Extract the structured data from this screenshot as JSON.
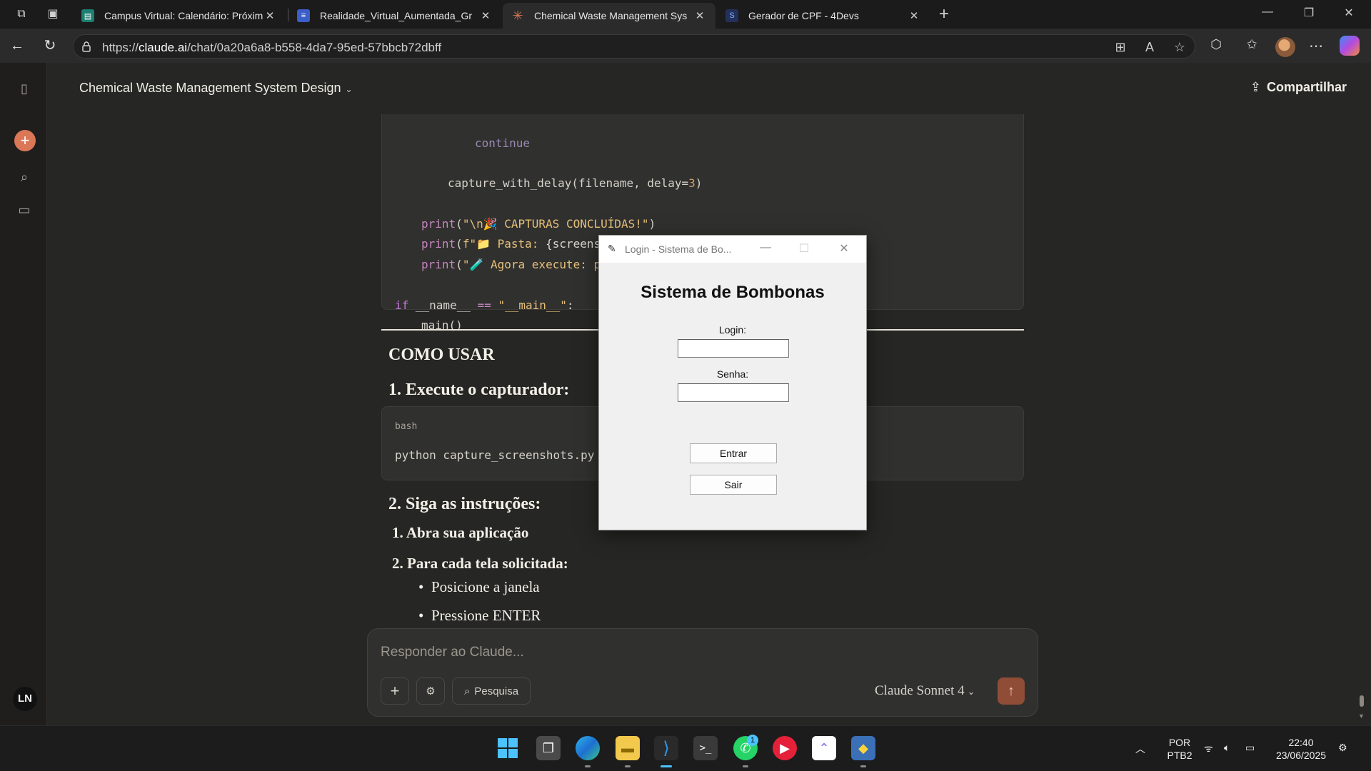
{
  "browser": {
    "tabs": [
      {
        "title": "Campus Virtual: Calendário: Próxim",
        "favicon": "campus-icon",
        "active": false
      },
      {
        "title": "Realidade_Virtual_Aumentada_Gr",
        "favicon": "document-icon",
        "active": false
      },
      {
        "title": "Chemical Waste Management Sys",
        "favicon": "claude-icon",
        "active": true
      },
      {
        "title": "Gerador de CPF - 4Devs",
        "favicon": "4devs-icon",
        "active": false
      }
    ],
    "url_prefix": "https://",
    "url_host": "claude.ai",
    "url_path": "/chat/0a20a6a8-b558-4da7-95ed-57bbcb72dbff"
  },
  "chat": {
    "title": "Chemical Waste Management System Design",
    "share_label": "Compartilhar",
    "user_initials": "LN"
  },
  "code_block_1": {
    "lines": {
      "continue": "continue",
      "capture": "capture_with_delay(filename, delay=3)",
      "print1": "print(\"\\n🎉 CAPTURAS CONCLUÍDAS!\")",
      "print2": "print(f\"📁 Pasta: {screenshots_dir.absolute()}\")",
      "print3": "print(\"🧪 Agora execute: python tests/test_e2e.py\")",
      "ifmain": "if __name__ == \"__main__\":",
      "main": "main()"
    }
  },
  "content": {
    "heading_como_usar": "COMO USAR",
    "heading_step1": "1. Execute o capturador:",
    "bash_lang": "bash",
    "bash_code": "python capture_screenshots.py",
    "heading_step2": "2. Siga as instruções:",
    "list_1": "1. Abra sua aplicação",
    "list_2": "2. Para cada tela solicitada:",
    "bullet_1": "Posicione a janela",
    "bullet_2": "Pressione ENTER"
  },
  "composer": {
    "placeholder": "Responder ao Claude...",
    "search_label": "Pesquisa",
    "model": "Claude Sonnet 4"
  },
  "dialog": {
    "window_title": "Login - Sistema de Bo...",
    "heading": "Sistema de Bombonas",
    "login_label": "Login:",
    "login_value": "",
    "senha_label": "Senha:",
    "senha_value": "",
    "enter_button": "Entrar",
    "exit_button": "Sair"
  },
  "taskbar": {
    "lang_top": "POR",
    "lang_bottom": "PTB2",
    "time": "22:40",
    "date": "23/06/2025",
    "whatsapp_badge": "1"
  },
  "colors": {
    "accent": "#d97757",
    "send_button": "#8f4d37",
    "app_bg": "#262624"
  }
}
